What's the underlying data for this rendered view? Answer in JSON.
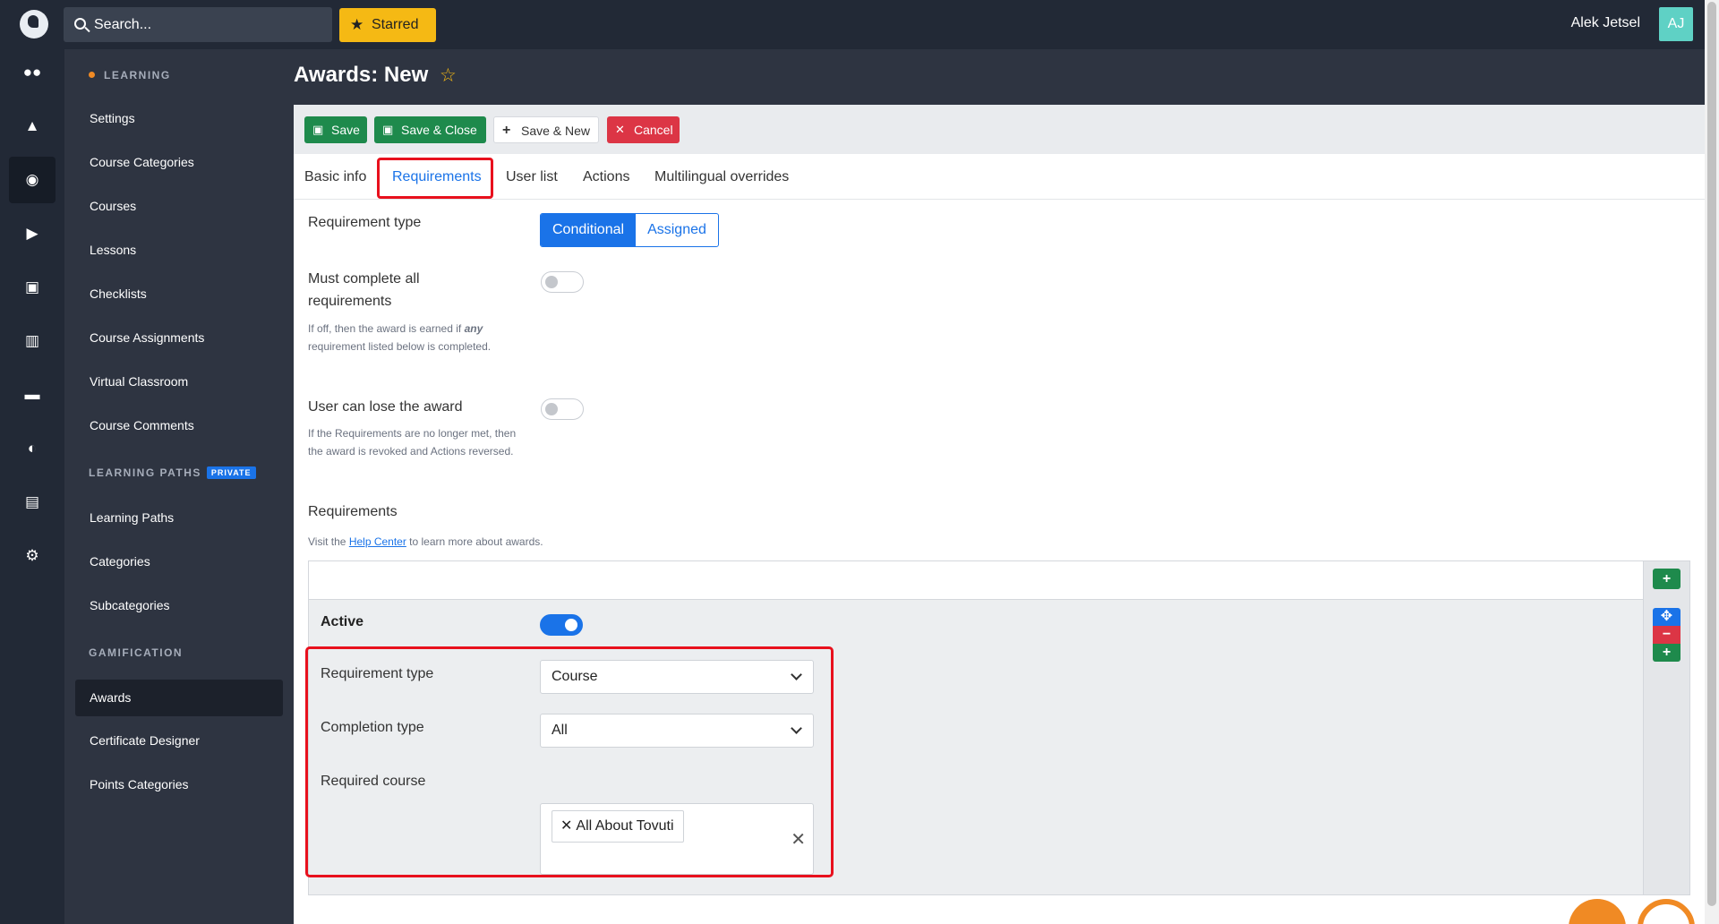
{
  "topbar": {
    "search_placeholder": "Search...",
    "starred_label": "Starred",
    "user_name": "Alek Jetsel",
    "avatar_initials": "AJ"
  },
  "rail_icons": [
    "users-icon",
    "shapes-icon",
    "graduation-cap-icon",
    "megaphone-icon",
    "money-icon",
    "chart-icon",
    "comment-icon",
    "palette-icon",
    "calendar-icon",
    "gear-icon"
  ],
  "sidebar": {
    "learning_heading": "LEARNING",
    "learning_items": [
      "Settings",
      "Course Categories",
      "Courses",
      "Lessons",
      "Checklists",
      "Course Assignments",
      "Virtual Classroom",
      "Course Comments"
    ],
    "paths_heading": "LEARNING PATHS",
    "private_badge": "PRIVATE",
    "paths_items": [
      "Learning Paths",
      "Categories",
      "Subcategories"
    ],
    "gamification_heading": "GAMIFICATION",
    "gamification_items": [
      "Awards",
      "Certificate Designer",
      "Points Categories"
    ],
    "active_item": "Awards"
  },
  "page": {
    "title": "Awards: New"
  },
  "toolbar": {
    "save_label": "Save",
    "save_close_label": "Save & Close",
    "save_new_label": "Save & New",
    "cancel_label": "Cancel"
  },
  "tabs": {
    "basic_info": "Basic info",
    "requirements": "Requirements",
    "user_list": "User list",
    "actions": "Actions",
    "multilingual": "Multilingual overrides",
    "active": "Requirements"
  },
  "form": {
    "requirement_type_label": "Requirement type",
    "requirement_type_options": [
      "Conditional",
      "Assigned"
    ],
    "requirement_type_selected": "Conditional",
    "must_complete_label": "Must complete all requirements",
    "must_complete_value": false,
    "must_complete_help_before": "If off, then the award is earned if ",
    "must_complete_help_emph": "any",
    "must_complete_help_after": " requirement listed below is completed.",
    "lose_award_label": "User can lose the award",
    "lose_award_value": false,
    "lose_award_help": "If the Requirements are no longer met, then the award is revoked and Actions reversed.",
    "requirements_heading": "Requirements",
    "requirements_help_before": "Visit the ",
    "requirements_help_link": "Help Center",
    "requirements_help_after": " to learn more about awards."
  },
  "requirement_row": {
    "active_label": "Active",
    "active_value": true,
    "type_label": "Requirement type",
    "type_value": "Course",
    "completion_label": "Completion type",
    "completion_value": "All",
    "course_label": "Required course",
    "course_chip": "All About Tovuti"
  },
  "colors": {
    "primary": "#1a73e8",
    "success": "#1e8a4c",
    "danger": "#dc3545",
    "starred": "#f5b914",
    "sidebar_bg": "#2e3441",
    "topbar_bg": "#222936",
    "highlight": "#e8101d"
  }
}
